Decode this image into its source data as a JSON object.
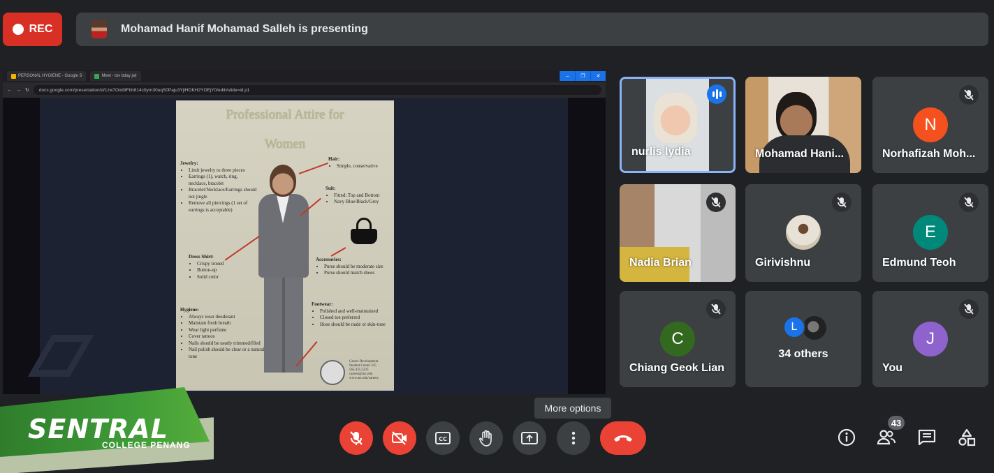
{
  "recording": {
    "label": "REC"
  },
  "presenting": {
    "text": "Mohamad Hanif Mohamad Salleh is presenting"
  },
  "shared_screen": {
    "browser_tabs": [
      "PERSONAL HYGIENE - Google S",
      "Meet - tov bday jwl"
    ],
    "url": "docs.google.com/presentation/d/1zw7Oiot9Fbh814c0yrn30uqS0Paju3YjlHOKH2YOEjY0/edit#slide=id.p1",
    "slide": {
      "title_line1": "Professional Attire for",
      "title_line2": "Women",
      "jewelry": {
        "heading": "Jewelry:",
        "items": [
          "Limit jewelry to three pieces",
          "Earrings (1), watch, ring, necklace, bracelet",
          "Bracelet/Necklace/Earrings should not jingle",
          "Remove all piercings (1 set of earrings is acceptable)"
        ]
      },
      "hair": {
        "heading": "Hair:",
        "items": [
          "Simple, conservative"
        ]
      },
      "suit": {
        "heading": "Suit:",
        "items": [
          "Fitted: Top and Bottom",
          "Navy Blue/Black/Grey"
        ]
      },
      "dress_shirt": {
        "heading": "Dress Shirt:",
        "items": [
          "Crispy ironed",
          "Button-up",
          "Solid color"
        ]
      },
      "accessories": {
        "heading": "Accessories:",
        "items": [
          "Purse should be moderate size",
          "Purse should match shoes"
        ]
      },
      "hygiene": {
        "heading": "Hygiene:",
        "items": [
          "Always wear deodorant",
          "Maintain fresh breath",
          "Wear light perfume",
          "Cover tattoos",
          "Nails should be neatly trimmed/filed",
          "Nail polish should be clear or a natural tone"
        ]
      },
      "footwear": {
        "heading": "Footwear:",
        "items": [
          "Polished and well-maintained",
          "Closed toe preferred",
          "Hose should be nude or skin-tone"
        ]
      },
      "footer_lines": [
        "Career Development",
        "Student Center 225",
        "565.435.5235",
        "careers@utc.edu",
        "www.utc.edu/careers"
      ]
    }
  },
  "participants": [
    {
      "name": "nurlis lydia",
      "type": "video",
      "speaking": true
    },
    {
      "name": "Mohamad Hani...",
      "type": "video"
    },
    {
      "name": "Norhafizah Moh...",
      "type": "avatar",
      "initial": "N",
      "color": "#f4511e",
      "muted": true
    },
    {
      "name": "Nadia Brian",
      "type": "video",
      "muted": true
    },
    {
      "name": "Girivishnu",
      "type": "photo-avatar",
      "muted": true
    },
    {
      "name": "Edmund Teoh",
      "type": "avatar",
      "initial": "E",
      "color": "#00897b",
      "muted": true
    },
    {
      "name": "Chiang Geok Lian",
      "type": "avatar",
      "initial": "C",
      "color": "#33691e",
      "muted": true
    },
    {
      "name": "34 others",
      "type": "group",
      "initial": "L"
    },
    {
      "name": "You",
      "type": "avatar",
      "initial": "J",
      "color": "#8e63ce",
      "muted": true
    }
  ],
  "toolbar": {
    "tooltip": "More options",
    "people_count": "43"
  },
  "logo": {
    "main": "SENTRAL",
    "sub": "COLLEGE PENANG"
  },
  "colors": {
    "accent": "#8ab4f8",
    "danger": "#ea4335",
    "surface": "#3c4043",
    "background": "#202124"
  }
}
